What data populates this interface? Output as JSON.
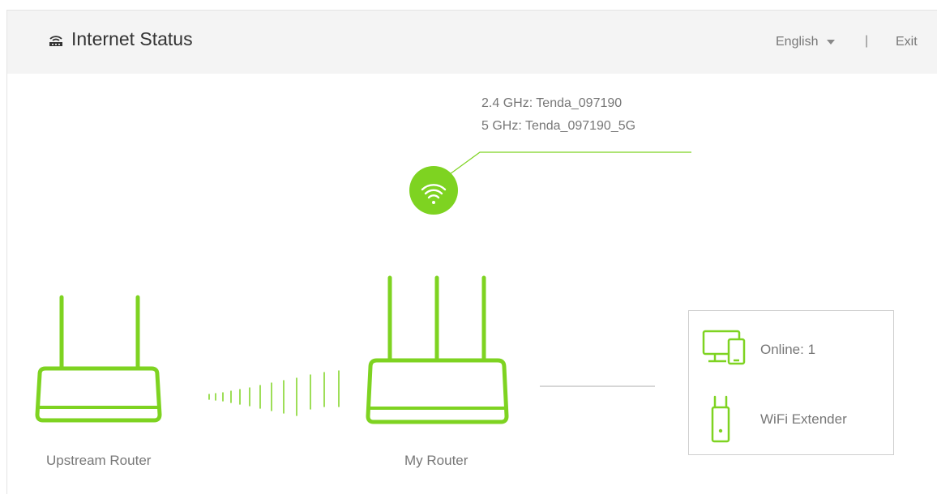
{
  "header": {
    "title": "Internet Status",
    "language": "English",
    "separator": "|",
    "exit": "Exit",
    "title_icon": "router-icon"
  },
  "wifi": {
    "ssid_24": "2.4 GHz: Tenda_097190",
    "ssid_5": "5 GHz: Tenda_097190_5G",
    "icon": "wifi-icon"
  },
  "devices": {
    "upstream_label": "Upstream Router",
    "my_router_label": "My Router"
  },
  "clients": {
    "online": "Online:  1",
    "extender": "WiFi Extender"
  },
  "colors": {
    "accent": "#7ed321",
    "header_bg": "#f4f4f4",
    "text": "#777777"
  }
}
